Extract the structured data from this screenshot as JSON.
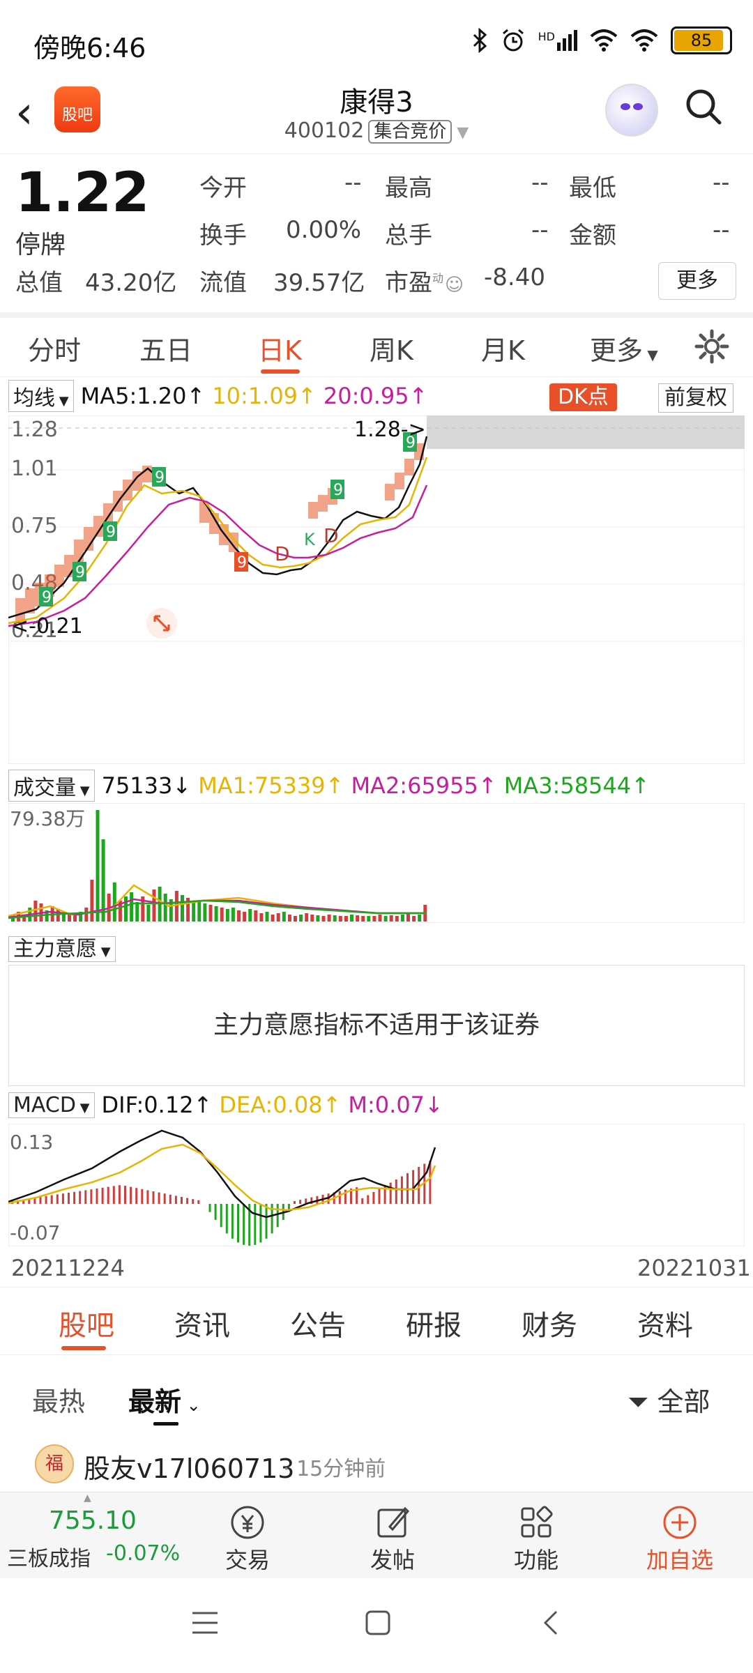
{
  "status": {
    "time": "傍晚6:46",
    "hd": "HD",
    "battery": "85"
  },
  "header": {
    "title": "康得3",
    "code": "400102",
    "market_tag": "集合竞价",
    "logo_text": "股吧"
  },
  "quote": {
    "price": "1.22",
    "status": "停牌",
    "open_label": "今开",
    "open": "--",
    "high_label": "最高",
    "high": "--",
    "low_label": "最低",
    "low": "--",
    "turnover_label": "换手",
    "turnover": "0.00%",
    "volume_label": "总手",
    "volume": "--",
    "amount_label": "金额",
    "amount": "--",
    "mcap_label": "总值",
    "mcap": "43.20亿",
    "float_label": "流值",
    "float": "39.57亿",
    "pe_label": "市盈",
    "pe_sup": "动",
    "pe": "-8.40",
    "more": "更多"
  },
  "tabs": [
    "分时",
    "五日",
    "日K",
    "周K",
    "月K",
    "更多"
  ],
  "ma": {
    "select": "均线",
    "ma5": "MA5:1.20",
    "ma10": "10:1.09",
    "ma20": "20:0.95",
    "dk": "DK点",
    "adjust": "前复权"
  },
  "kline": {
    "y_ticks": [
      "1.28",
      "1.01",
      "0.75",
      "0.48",
      "0.21"
    ],
    "high_marker": "1.28->",
    "low_marker": "<-0.21",
    "d_label": "D",
    "k_label": "K",
    "nine": "9"
  },
  "volume": {
    "select": "成交量",
    "value": "75133",
    "ma1": "MA1:75339",
    "ma2": "MA2:65955",
    "ma3": "MA3:58544",
    "y_max": "79.38万"
  },
  "intent": {
    "select": "主力意愿",
    "message": "主力意愿指标不适用于该证券"
  },
  "macd": {
    "select": "MACD",
    "dif": "DIF:0.12",
    "dea": "DEA:0.08",
    "m": "M:0.07",
    "y_top": "0.13",
    "y_bottom": "-0.07"
  },
  "dates": {
    "start": "20211224",
    "end": "20221031"
  },
  "subtabs": [
    "股吧",
    "资讯",
    "公告",
    "研报",
    "财务",
    "资料"
  ],
  "filters": {
    "hot": "最热",
    "latest": "最新",
    "all": "全部"
  },
  "post": {
    "user": "股友v17l060713",
    "time": "15分钟前"
  },
  "bottom": {
    "index_value": "755.10",
    "index_name": "三板成指",
    "index_change": "-0.07%",
    "trade": "交易",
    "post": "发帖",
    "func": "功能",
    "add": "加自选"
  },
  "colors": {
    "accent": "#e8502a",
    "ma5": "#111111",
    "ma10": "#e8b400",
    "ma20": "#c81d9e",
    "up": "#d23c3c",
    "down": "#1fa61f",
    "index_green": "#1a9c3a"
  }
}
